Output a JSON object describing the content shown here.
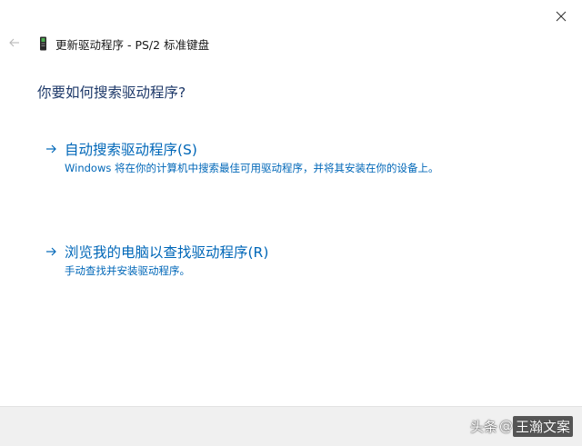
{
  "window": {
    "close_icon": "close-icon",
    "back_icon": "arrow-left-icon",
    "title_icon": "keyboard-device-icon",
    "title": "更新驱动程序 - PS/2 标准键盘"
  },
  "heading": "你要如何搜索驱动程序?",
  "options": [
    {
      "icon": "arrow-right-icon",
      "title": "自动搜索驱动程序(S)",
      "description": "Windows 将在你的计算机中搜索最佳可用驱动程序，并将其安装在你的设备上。"
    },
    {
      "icon": "arrow-right-icon",
      "title": "浏览我的电脑以查找驱动程序(R)",
      "description": "手动查找并安装驱动程序。"
    }
  ],
  "watermark": {
    "prefix": "头条",
    "at": "@",
    "name": "王瀚文案"
  },
  "colors": {
    "link_blue": "#0067b8",
    "heading_navy": "#1f3a6a",
    "footer_bg": "#f0f0f0"
  }
}
